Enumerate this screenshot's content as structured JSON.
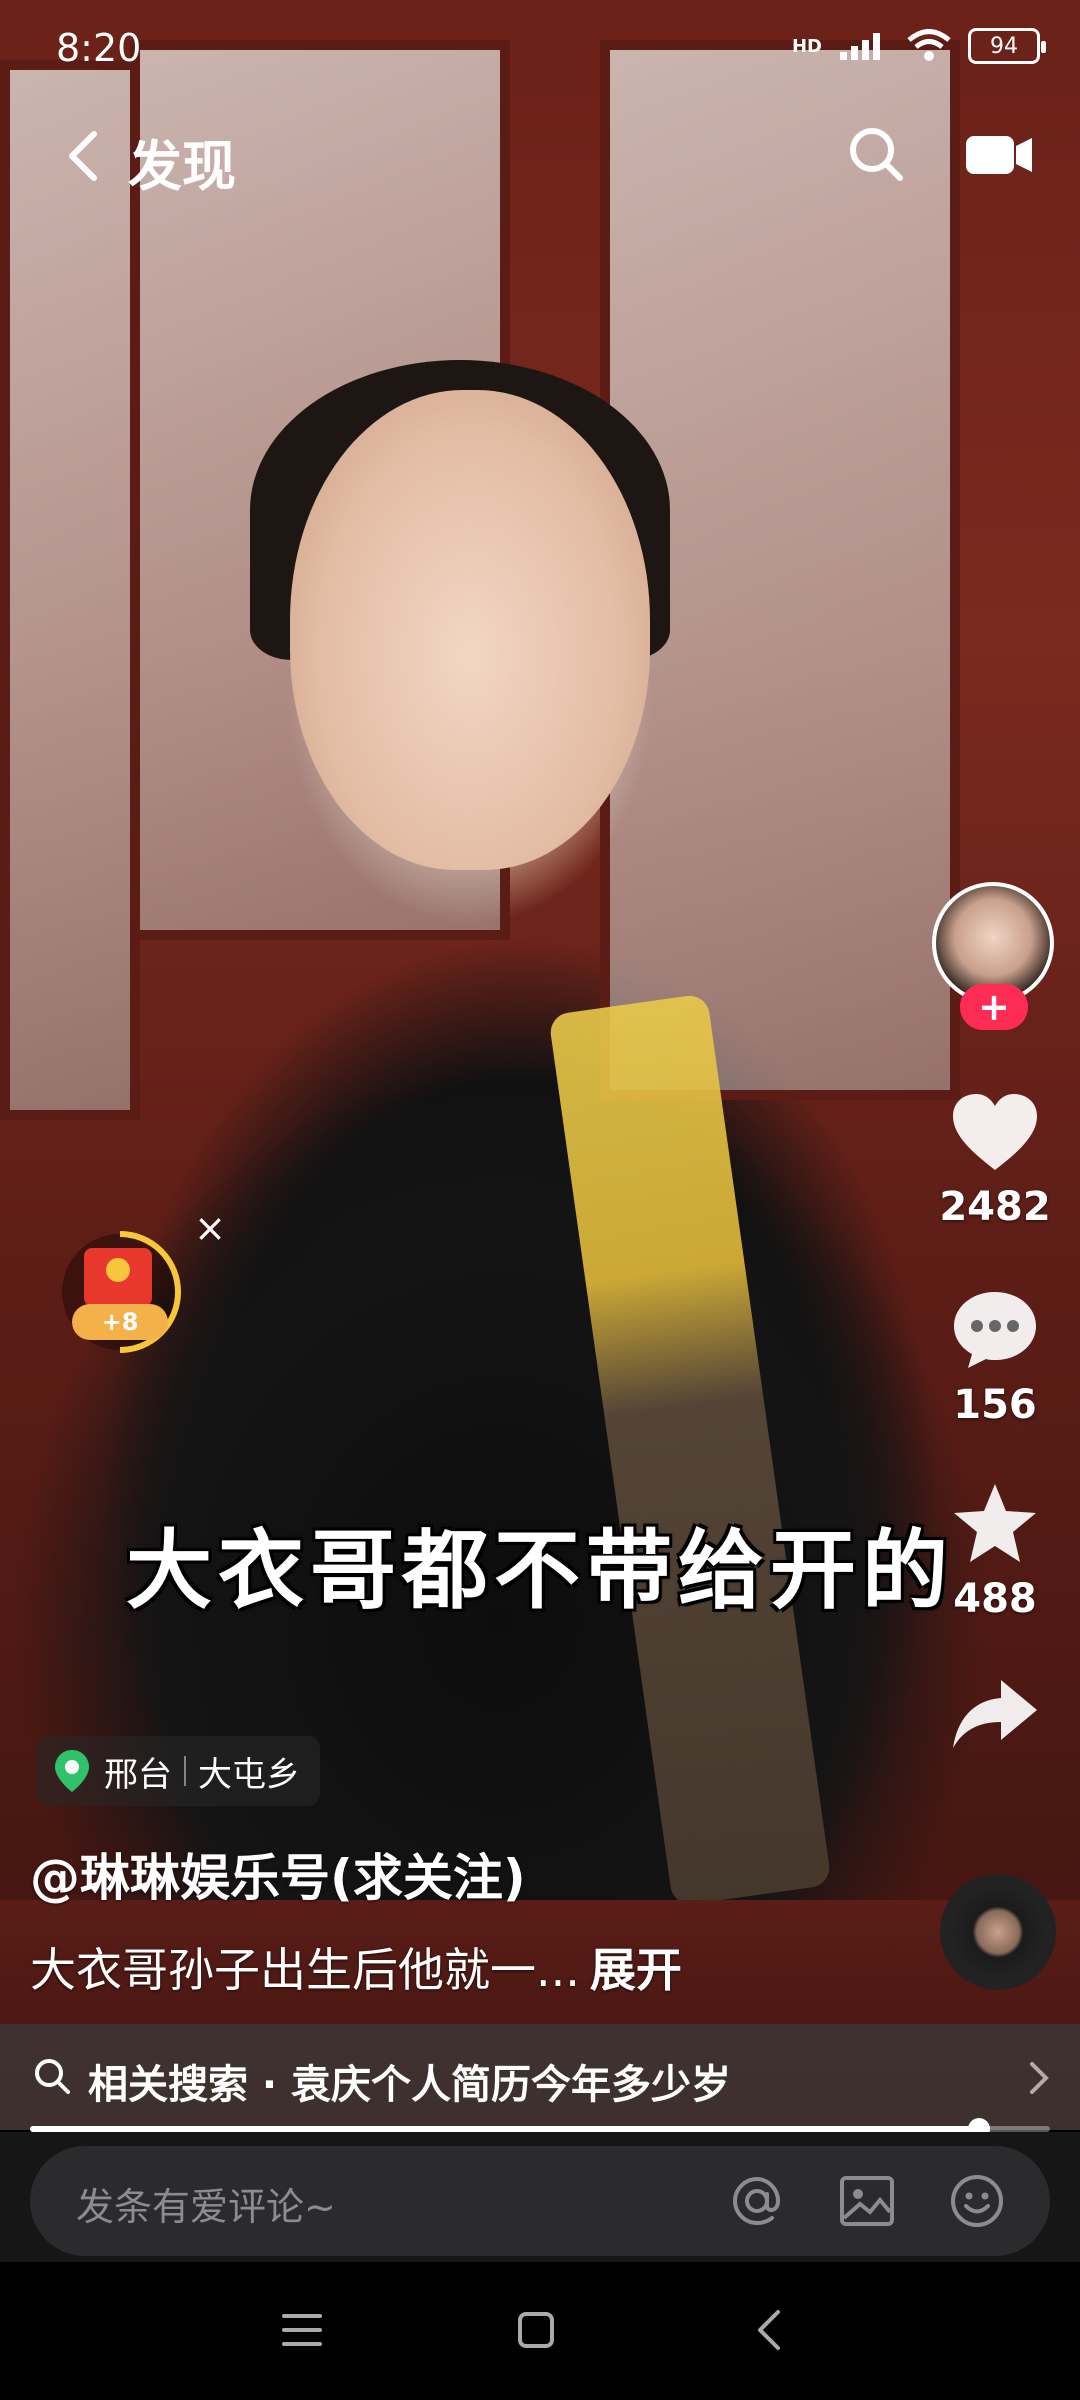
{
  "status_bar": {
    "time": "8:20",
    "network": "HD",
    "battery": "94"
  },
  "nav": {
    "title": "发现"
  },
  "rail": {
    "likes": "2482",
    "comments": "156",
    "favorites": "488",
    "follow_symbol": "+"
  },
  "packet": {
    "bonus": "+8",
    "close": "×"
  },
  "video": {
    "subtitle": "大衣哥都不带给开的"
  },
  "location": {
    "city": "邢台",
    "area": "大屯乡"
  },
  "author": "@琳琳娱乐号(求关注)",
  "description": {
    "text": "大衣哥孙子出生后他就一...",
    "expand": "展开"
  },
  "related": {
    "label": "相关搜索 · 袁庆个人简历今年多少岁"
  },
  "progress": {
    "played_fraction": 0.93
  },
  "comment": {
    "placeholder": "发条有爱评论~"
  },
  "colors": {
    "accent": "#fe2c55",
    "packet_ring": "#f7c63b"
  }
}
